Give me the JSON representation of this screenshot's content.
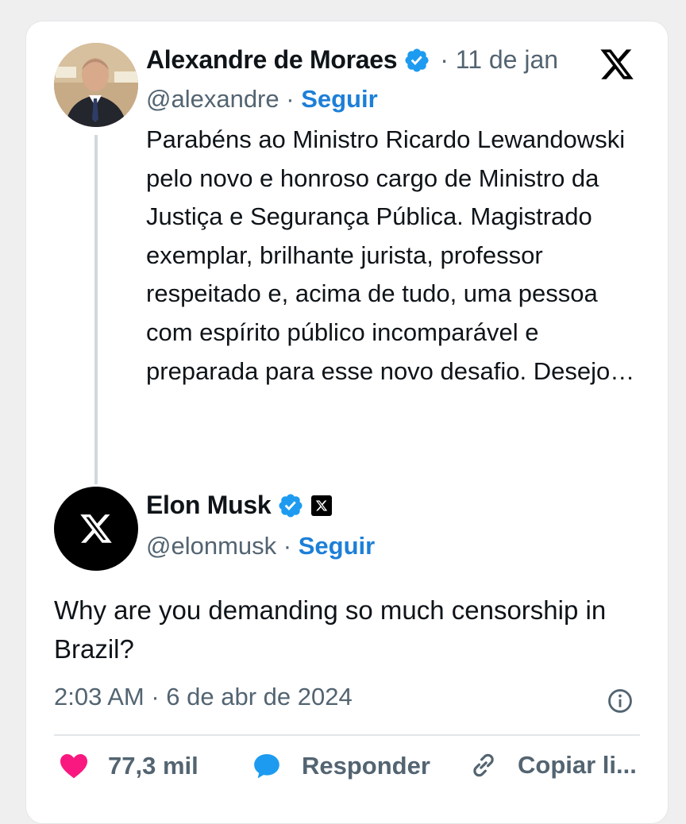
{
  "quoted_post": {
    "author_name": "Alexandre de Moraes",
    "date": "· 11 de jan",
    "handle": "@alexandre",
    "separator": " · ",
    "follow_label": "Seguir",
    "text": "Parabéns ao Ministro Ricardo Lewandowski pelo novo e honroso cargo de Ministro da Justiça e Segurança Pública. Magistrado exemplar, brilhante jurista, professor respeitado e, acima de tudo, uma pessoa com espírito público incomparável e preparada para esse novo desafio. Desejo…"
  },
  "reply_post": {
    "author_name": "Elon Musk",
    "handle": "@elonmusk",
    "separator": " · ",
    "follow_label": "Seguir",
    "text": "Why are you demanding so much censorship in Brazil?",
    "timestamp": "2:03 AM · 6 de abr de 2024"
  },
  "actions": {
    "likes": "77,3 mil",
    "reply_label": "Responder",
    "copy_label": "Copiar li..."
  },
  "colors": {
    "verified": "#1d9bf0",
    "follow": "#1d7fd8",
    "like": "#f91880",
    "reply_icon": "#1d9bf0",
    "muted": "#536471"
  },
  "icons": [
    "x-logo-icon",
    "verified-badge-icon",
    "affiliate-x-icon",
    "info-icon",
    "heart-icon",
    "reply-bubble-icon",
    "link-icon"
  ]
}
